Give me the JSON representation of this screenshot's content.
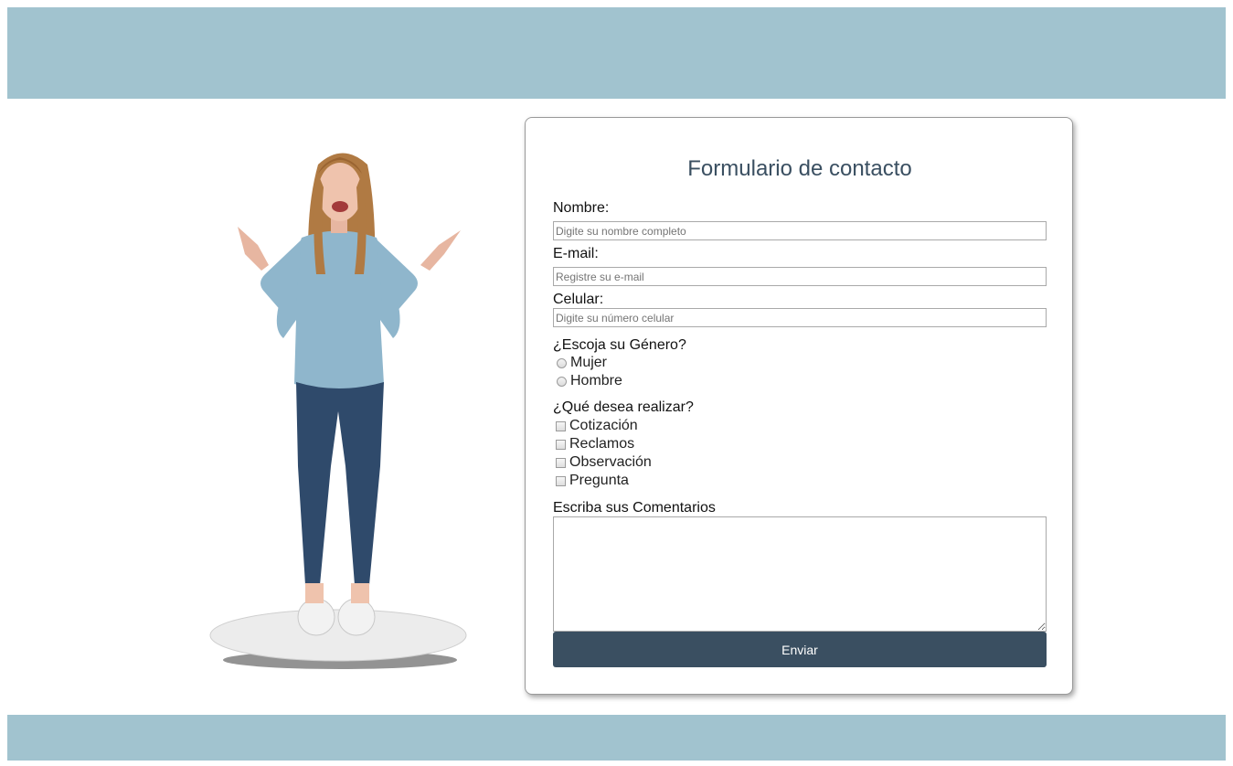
{
  "form": {
    "title": "Formulario de contacto",
    "name_label": "Nombre:",
    "name_placeholder": "Digite su nombre completo",
    "email_label": "E-mail:",
    "email_placeholder": "Registre su e-mail",
    "phone_label": "Celular:",
    "phone_placeholder": "Digite su número celular",
    "gender_label": "¿Escoja su Género?",
    "gender_options": [
      "Mujer",
      "Hombre"
    ],
    "action_label": "¿Qué desea realizar?",
    "action_options": [
      "Cotización",
      "Reclamos",
      "Observación",
      "Pregunta"
    ],
    "comments_label": "Escriba sus Comentarios",
    "submit_label": "Enviar"
  },
  "colors": {
    "band": "#a1c3cf",
    "accent": "#3a4f61"
  }
}
